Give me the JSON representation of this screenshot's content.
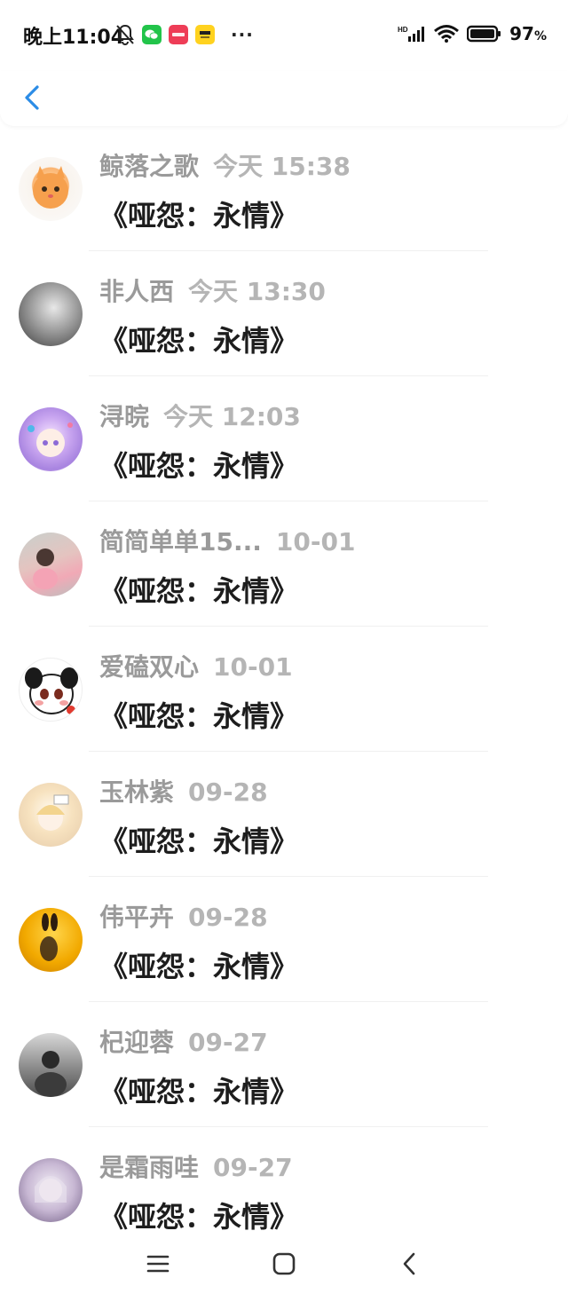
{
  "status_bar": {
    "time": "晚上11:04",
    "apps": [
      "wechat",
      "小红书",
      "美团"
    ],
    "overflow": "···",
    "battery": "97",
    "battery_unit": "%",
    "network": "HD"
  },
  "header": {
    "back_icon": "chevron-left-icon",
    "accent": "#2b8ce6"
  },
  "messages": [
    {
      "user": "鲸落之歌",
      "time": "今天 15:38",
      "text": "《哑怨：永情》"
    },
    {
      "user": "非人西",
      "time": "今天 13:30",
      "text": "《哑怨：永情》"
    },
    {
      "user": "浔晥",
      "time": "今天 12:03",
      "text": "《哑怨：永情》"
    },
    {
      "user": "简简单单15...",
      "time": "10-01",
      "text": "《哑怨：永情》"
    },
    {
      "user": "爱磕双心",
      "time": "10-01",
      "text": "《哑怨：永情》"
    },
    {
      "user": "玉林紫",
      "time": "09-28",
      "text": "《哑怨：永情》"
    },
    {
      "user": "伟平卉",
      "time": "09-28",
      "text": "《哑怨：永情》"
    },
    {
      "user": "杞迎蓉",
      "time": "09-27",
      "text": "《哑怨：永情》"
    },
    {
      "user": "是霜雨哇",
      "time": "09-27",
      "text": "《哑怨：永情》"
    }
  ],
  "bottom_nav": {
    "items": [
      "menu-icon",
      "home-icon",
      "back-icon"
    ]
  }
}
